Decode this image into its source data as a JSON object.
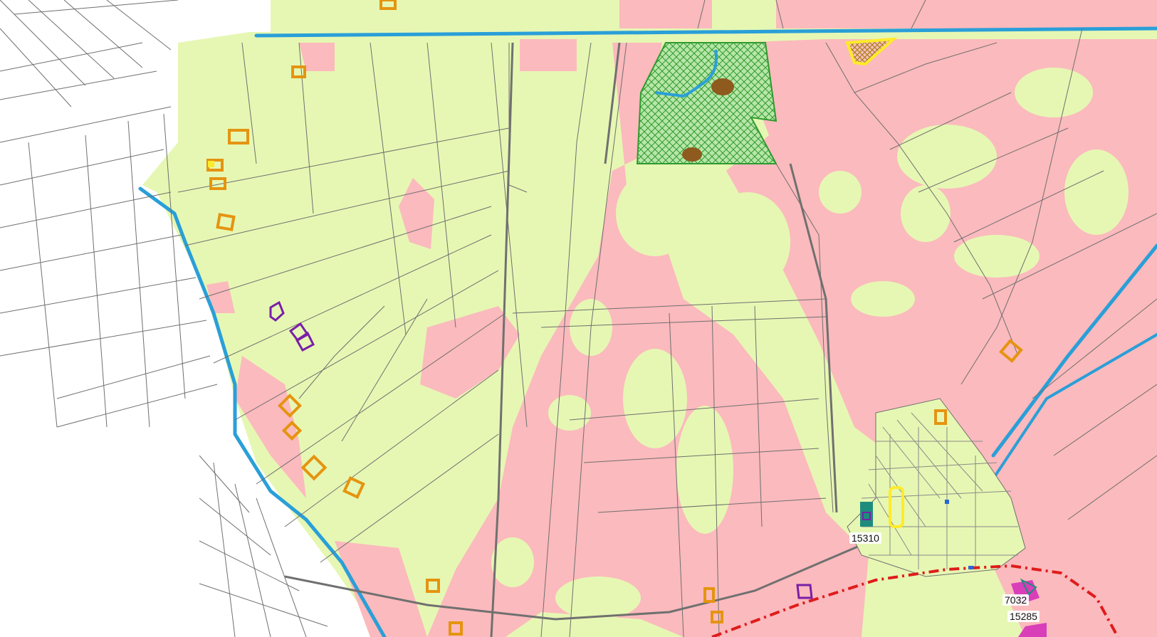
{
  "map": {
    "labels": {
      "l15310": "15310",
      "l7032": "7032",
      "l15285": "15285"
    },
    "colors": {
      "agri_green": "#e6f7b3",
      "built_pink": "#fbbabd",
      "nature_green": "#2f9a2f",
      "water_blue": "#2a9fd8",
      "parcel_line": "#6f6f6f",
      "marker_orange": "#e59410",
      "marker_yellow": "#ffeb2a",
      "marker_purple": "#7a1fa8",
      "boundary_red": "#e01b1b",
      "teal": "#1e8c7d",
      "magenta": "#d83fb8",
      "brown": "#8e5a1e"
    },
    "icons": [
      "cross-hatched-nature-area",
      "farm-marker-icon",
      "boundary-dashed-red-line"
    ]
  }
}
